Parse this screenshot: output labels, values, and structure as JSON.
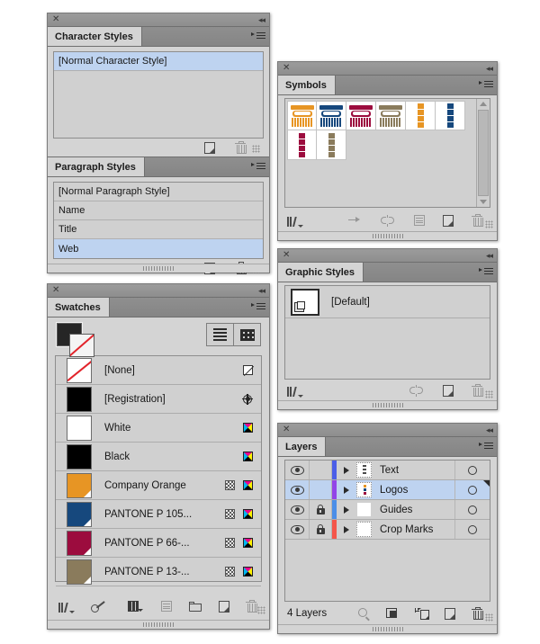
{
  "app": {
    "background": "#ffffff",
    "panel_bg": "#d4d4d4",
    "selection_blue": "#bed3f0",
    "tab_active_bg": "#d4d4d4"
  },
  "panels": {
    "character_styles": {
      "title": "Character Styles",
      "close_icon": "close-icon",
      "collapse_icon": "collapse-to-icons-icon",
      "menu_icon": "panel-menu-icon",
      "items": [
        {
          "label": "[Normal Character Style]",
          "selected": true
        }
      ],
      "footer": {
        "new_style_icon": "new-style-icon",
        "delete_icon": "delete-icon",
        "delete_disabled": true,
        "resize_icon": "resize-grip-icon"
      }
    },
    "paragraph_styles": {
      "title": "Paragraph Styles",
      "close_icon": "close-icon",
      "menu_icon": "panel-menu-icon",
      "items": [
        {
          "label": "[Normal Paragraph Style]",
          "selected": false
        },
        {
          "label": "Name",
          "selected": false
        },
        {
          "label": "Title",
          "selected": false
        },
        {
          "label": "Web",
          "selected": true
        }
      ],
      "footer": {
        "new_style_icon": "new-style-icon",
        "delete_icon": "delete-icon",
        "delete_disabled": false,
        "resize_icon": "resize-grip-icon"
      }
    },
    "swatches": {
      "title": "Swatches",
      "close_icon": "close-icon",
      "collapse_icon": "collapse-to-icons-icon",
      "menu_icon": "panel-menu-icon",
      "fill_color": "#262626",
      "stroke_color": "#ffffff",
      "stroke_is_none": true,
      "view_buttons": [
        {
          "name": "list-view-button",
          "icon": "list-view-icon",
          "active": false
        },
        {
          "name": "grid-view-button",
          "icon": "grid-view-icon",
          "active": false
        }
      ],
      "rows": [
        {
          "label": "[None]",
          "color": "#ffffff",
          "kind": "none",
          "tint": false,
          "right_icon": "none-swatch-icon"
        },
        {
          "label": "[Registration]",
          "color": "#000000",
          "kind": "solid",
          "tint": false,
          "right_icon": "registration-icon"
        },
        {
          "label": "White",
          "color": "#ffffff",
          "kind": "solid",
          "tint": false,
          "right_icon": "cmyk-icon"
        },
        {
          "label": "Black",
          "color": "#000000",
          "kind": "solid",
          "tint": false,
          "right_icon": "cmyk-icon"
        },
        {
          "label": "Company Orange",
          "color": "#e79524",
          "kind": "spot",
          "tint": true,
          "right_icon": "cmyk-icon"
        },
        {
          "label": "PANTONE P 105...",
          "color": "#16487d",
          "kind": "spot",
          "tint": true,
          "right_icon": "cmyk-icon"
        },
        {
          "label": "PANTONE P 66-...",
          "color": "#9c0c3e",
          "kind": "spot",
          "tint": true,
          "right_icon": "cmyk-icon"
        },
        {
          "label": "PANTONE P 13-...",
          "color": "#8a7b5c",
          "kind": "spot",
          "tint": true,
          "right_icon": "cmyk-icon"
        }
      ],
      "footer_icons": [
        "swatch-libraries-icon",
        "show-swatch-kinds-icon",
        "new-color-group-icon",
        "swatch-options-icon",
        "new-folder-icon",
        "new-swatch-icon",
        "delete-swatch-icon"
      ]
    },
    "symbols": {
      "title": "Symbols",
      "close_icon": "close-icon",
      "collapse_icon": "collapse-to-icons-icon",
      "menu_icon": "panel-menu-icon",
      "items": [
        {
          "name": "column-logo-orange",
          "type": "column",
          "color": "#e79524"
        },
        {
          "name": "column-logo-blue",
          "type": "column",
          "color": "#16487d"
        },
        {
          "name": "column-logo-maroon",
          "type": "column",
          "color": "#9c0c3e"
        },
        {
          "name": "column-logo-tan",
          "type": "column",
          "color": "#8a7b5c"
        },
        {
          "name": "stack-icons-orange",
          "type": "stack",
          "color": "#e79524"
        },
        {
          "name": "stack-icons-blue",
          "type": "stack",
          "color": "#16487d"
        },
        {
          "name": "stack-icons-maroon",
          "type": "stack",
          "color": "#9c0c3e"
        },
        {
          "name": "stack-icons-tan",
          "type": "stack",
          "color": "#8a7b5c"
        }
      ],
      "scrollbar": {
        "up_arrow": "scroll-up-icon",
        "down_arrow": "scroll-down-icon"
      },
      "footer_icons": [
        "symbol-libraries-icon",
        "place-symbol-instance-icon",
        "break-link-icon",
        "symbol-options-icon",
        "new-symbol-icon",
        "delete-symbol-icon"
      ]
    },
    "graphic_styles": {
      "title": "Graphic Styles",
      "close_icon": "close-icon",
      "collapse_icon": "collapse-to-icons-icon",
      "menu_icon": "panel-menu-icon",
      "items": [
        {
          "label": "[Default]",
          "thumb": "default-style-thumbnail"
        }
      ],
      "footer_icons": [
        "graphic-style-libraries-icon",
        "break-link-icon",
        "new-graphic-style-icon",
        "delete-graphic-style-icon"
      ]
    },
    "layers": {
      "title": "Layers",
      "close_icon": "close-icon",
      "collapse_icon": "collapse-to-icons-icon",
      "menu_icon": "panel-menu-icon",
      "columns": [
        "visibility",
        "lock",
        "color",
        "expand",
        "thumbnail",
        "name",
        "target"
      ],
      "rows": [
        {
          "name": "Text",
          "visible": true,
          "locked": false,
          "color": "#4b5ee8",
          "selected": false,
          "thumb": "text-layer-thumbnail"
        },
        {
          "name": "Logos",
          "visible": true,
          "locked": false,
          "color": "#9245e8",
          "selected": true,
          "thumb": "logos-layer-thumbnail"
        },
        {
          "name": "Guides",
          "visible": true,
          "locked": true,
          "color": "#4b8ee8",
          "selected": false,
          "thumb": "guides-layer-thumbnail"
        },
        {
          "name": "Crop Marks",
          "visible": true,
          "locked": true,
          "color": "#f4554a",
          "selected": false,
          "thumb": "crop-marks-layer-thumbnail"
        }
      ],
      "footer": {
        "count_label": "4 Layers",
        "icons": [
          "locate-object-icon",
          "make-clipping-mask-icon",
          "create-new-sublayer-icon",
          "create-new-layer-icon",
          "delete-selection-icon"
        ]
      }
    }
  }
}
